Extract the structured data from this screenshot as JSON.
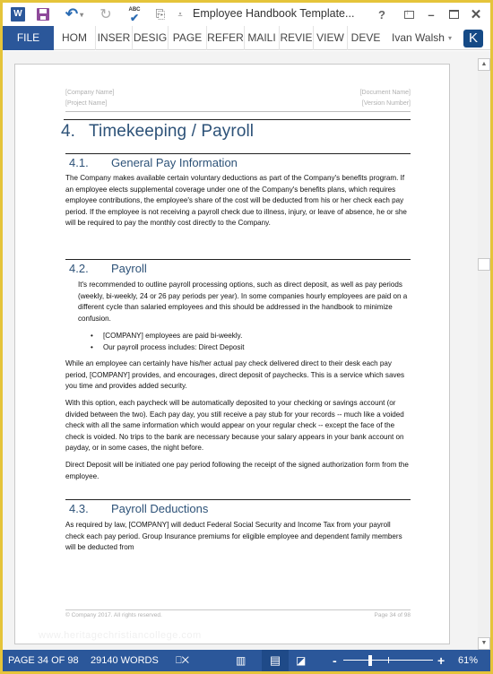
{
  "titlebar": {
    "app_icon_letter": "W",
    "undo_glyph": "↶",
    "undo_caret": "▾",
    "redo_glyph": "↻",
    "spell_abc": "ABC",
    "spell_check": "✔",
    "touch_glyph": "⎘",
    "customize_glyph": "⩡",
    "document_title": "Employee Handbook Template...",
    "help_glyph": "?",
    "minimize_glyph": "–",
    "close_glyph": "✕"
  },
  "ribbon": {
    "tabs": [
      {
        "label": "FILE"
      },
      {
        "label": "HOM"
      },
      {
        "label": "INSER"
      },
      {
        "label": "DESIG"
      },
      {
        "label": "PAGE"
      },
      {
        "label": "REFER"
      },
      {
        "label": "MAILI"
      },
      {
        "label": "REVIE"
      },
      {
        "label": "VIEW"
      },
      {
        "label": "DEVE"
      }
    ],
    "user_name": "Ivan Walsh",
    "user_caret": "▾",
    "user_initial": "K"
  },
  "document": {
    "header": {
      "company_name": "[Company Name]",
      "project_name": "[Project Name]",
      "document_name": "[Document Name]",
      "version_number": "[Version Number]"
    },
    "h1": {
      "number": "4.",
      "title": "Timekeeping / Payroll"
    },
    "sections": [
      {
        "number": "4.1.",
        "title": "General Pay Information",
        "paragraphs": [
          "The Company makes available certain voluntary deductions as part of the Company's benefits program. If an employee elects supplemental coverage under one of the Company's benefits plans, which requires employee contributions, the employee's share of the cost will be deducted from his or her check each pay period. If the employee is not receiving a payroll check due to illness, injury, or leave of absence, he or she will be required to pay the monthly cost directly to the Company."
        ]
      },
      {
        "number": "4.2.",
        "title": "Payroll",
        "paragraphs": [
          "It's recommended to outline payroll processing options, such as direct deposit, as well as pay periods (weekly, bi-weekly, 24 or 26 pay periods per year). In some companies hourly employees are paid on a different cycle than salaried employees and this should be addressed in the handbook to minimize confusion.",
          "While an employee can certainly have his/her actual pay check delivered direct to their desk each pay period, [COMPANY] provides, and encourages, direct deposit of paychecks. This is a service which saves you time and provides added security.",
          "With this option, each paycheck will be automatically deposited to your checking or savings account (or divided between the two). Each pay day, you still receive a pay stub for your records -- much like a voided check with all the same information which would appear on your regular check -- except the face of the check is voided. No trips to the bank are necessary because your salary appears in your bank account on payday, or in some cases, the night before.",
          "Direct Deposit will be initiated one pay period following the receipt of the signed authorization form from the employee."
        ],
        "bullets": [
          "[COMPANY] employees are paid bi-weekly.",
          "Our payroll process includes: Direct Deposit"
        ]
      },
      {
        "number": "4.3.",
        "title": "Payroll Deductions",
        "paragraphs": [
          "As required by law, [COMPANY] will deduct Federal Social Security and Income Tax from your payroll check each pay period. Group Insurance premiums for eligible employee and dependent family members will be deducted from"
        ]
      }
    ],
    "footer": {
      "copyright": "© Company 2017. All rights reserved.",
      "page_label": "Page 34 of 98"
    },
    "watermark": "www.heritagechristiancollege.com"
  },
  "scrollbar": {
    "up_glyph": "▲",
    "down_glyph": "▼"
  },
  "statusbar": {
    "page": "PAGE 34 OF 98",
    "words": "29140 WORDS",
    "proofing_glyph": "⎕✕",
    "read_mode_glyph": "▥",
    "print_layout_glyph": "▤",
    "web_layout_glyph": "◪",
    "zoom_minus": "-",
    "zoom_plus": "+",
    "zoom_percent": "61%",
    "zoom_value": 61
  },
  "colors": {
    "accent": "#2b579a",
    "window_border": "#e5c43a",
    "heading": "#2d5278",
    "avatar": "#154a86"
  }
}
